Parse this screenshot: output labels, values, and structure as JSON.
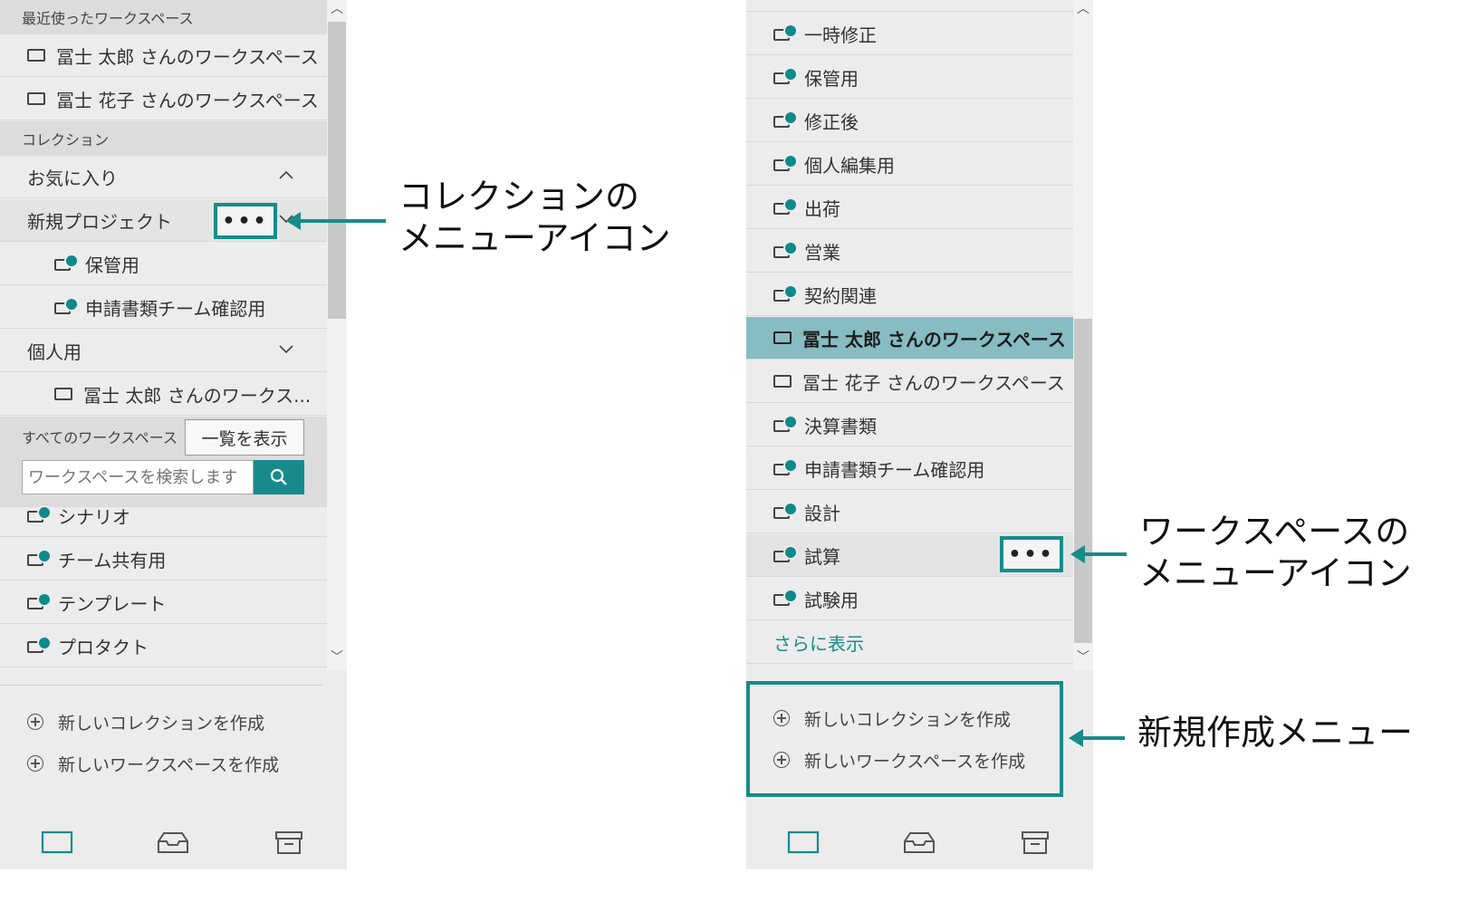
{
  "left_panel": {
    "recent_header": "最近使ったワークスペース",
    "recent_items": [
      "冨士 太郎 さんのワークスペース",
      "冨士 花子 さんのワークスペース"
    ],
    "collections_header": "コレクション",
    "favorites_label": "お気に入り",
    "new_project_label": "新規プロジェクト",
    "new_project_items": [
      "保管用",
      "申請書類チーム確認用"
    ],
    "personal_label": "個人用",
    "personal_items": [
      "冨士 太郎 さんのワークス..."
    ],
    "all_workspaces_header": "すべてのワークスペース",
    "list_button": "一覧を表示",
    "search_placeholder": "ワークスペースを検索します",
    "workspaces": [
      "シナリオ",
      "チーム共有用",
      "テンプレート",
      "プロタクト"
    ],
    "create_collection": "新しいコレクションを作成",
    "create_workspace": "新しいワークスペースを作成",
    "more_button": "•••"
  },
  "right_panel": {
    "workspaces": [
      "一時修正",
      "保管用",
      "修正後",
      "個人編集用",
      "出荷",
      "営業",
      "契約関連",
      "冨士 太郎 さんのワークスペース",
      "冨士 花子 さんのワークスペース",
      "決算書類",
      "申請書類チーム確認用",
      "設計",
      "試算",
      "試験用"
    ],
    "show_more": "さらに表示",
    "create_collection": "新しいコレクションを作成",
    "create_workspace": "新しいワークスペースを作成",
    "more_button": "•••"
  },
  "callouts": {
    "collection_menu": [
      "コレクションの",
      "メニューアイコン"
    ],
    "workspace_menu": [
      "ワークスペースの",
      "メニューアイコン"
    ],
    "create_menu": "新規作成メニュー"
  },
  "colors": {
    "accent": "#178b8b",
    "panel_bg": "#ececec",
    "selected_bg": "#86bcc2"
  }
}
